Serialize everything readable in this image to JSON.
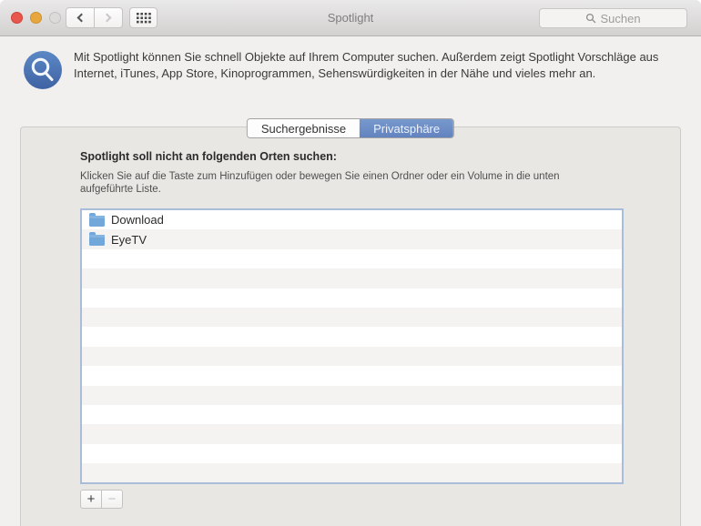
{
  "window": {
    "title": "Spotlight"
  },
  "titlebar": {
    "search_placeholder": "Suchen",
    "icons": {
      "close": "red-circle",
      "minimize": "yellow-circle",
      "fullscreen": "gray-circle",
      "back": "chevron-left",
      "forward": "chevron-right",
      "show_all": "grid-of-12-dots",
      "search": "magnifier"
    }
  },
  "intro": {
    "icon": "spotlight-magnifier-blue-circle",
    "text": "Mit Spotlight können Sie schnell Objekte auf Ihrem Computer suchen. Außerdem zeigt Spotlight Vorschläge aus Internet, iTunes, App Store, Kinoprogrammen, Sehenswürdigkeiten in der Nähe und vieles mehr an."
  },
  "tabs": [
    {
      "label": "Suchergebnisse",
      "active": false
    },
    {
      "label": "Privatsphäre",
      "active": true
    }
  ],
  "privacy": {
    "heading": "Spotlight soll nicht an folgenden Orten suchen:",
    "description": "Klicken Sie auf die Taste zum Hinzufügen oder bewegen Sie einen Ordner oder ein Volume in die unten aufgeführte Liste.",
    "items": [
      {
        "name": "Download",
        "icon": "folder-icon"
      },
      {
        "name": "EyeTV",
        "icon": "folder-icon"
      }
    ],
    "visible_rows": 14,
    "add_label": "+",
    "remove_label": "−",
    "remove_enabled": false
  },
  "colors": {
    "active_tab_top": "#7899cd",
    "active_tab_bottom": "#6283bf",
    "folder_blue": "#72a7d9",
    "list_border": "#a9bcd8",
    "row_stripe": "#f4f3f1",
    "panel_bg": "#e8e7e4",
    "spotlight_icon_top": "#5c88c6",
    "spotlight_icon_bottom": "#3f62a3",
    "traffic_red": "#e8564d",
    "traffic_yellow": "#e7a73e"
  }
}
